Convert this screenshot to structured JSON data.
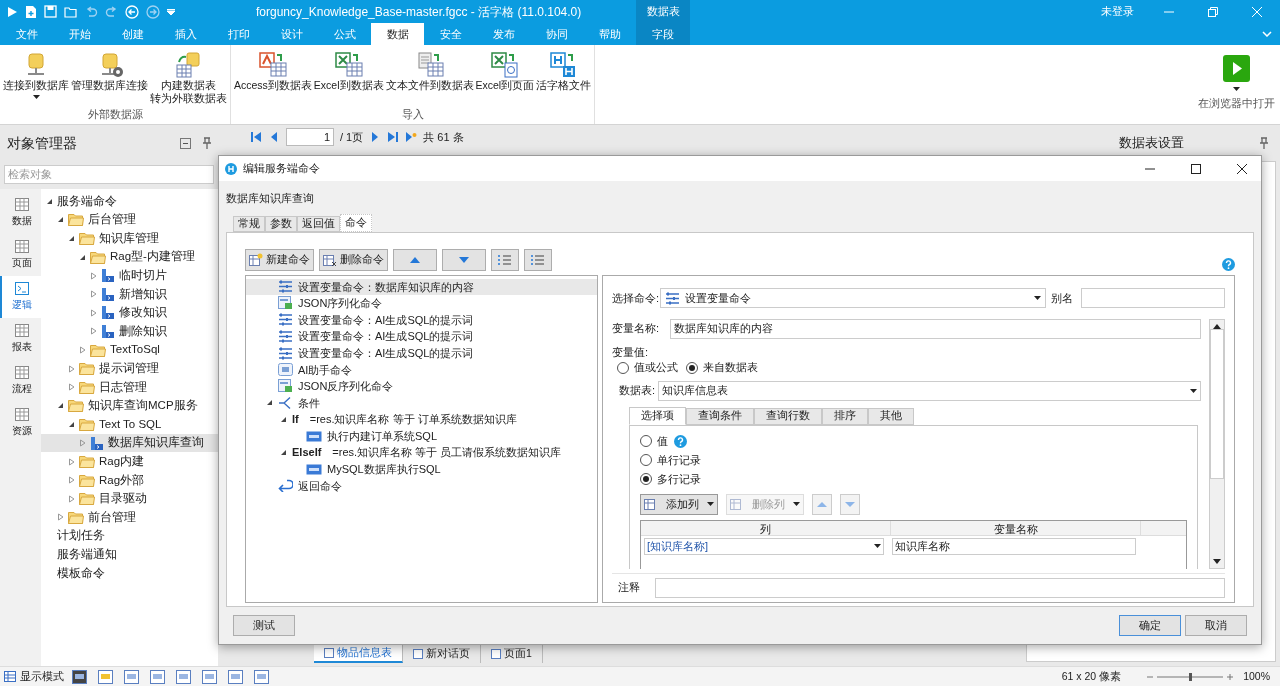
{
  "window": {
    "title": "forguncy_Knowledge_Base-master.fgcc - 活字格 (11.0.104.0)",
    "account": "未登录"
  },
  "ribbon_tabs": [
    {
      "label": "文件",
      "selected": false
    },
    {
      "label": "开始",
      "selected": false
    },
    {
      "label": "创建",
      "selected": false
    },
    {
      "label": "插入",
      "selected": false
    },
    {
      "label": "打印",
      "selected": false
    },
    {
      "label": "设计",
      "selected": false
    },
    {
      "label": "公式",
      "selected": false
    },
    {
      "label": "数据",
      "selected": true
    },
    {
      "label": "安全",
      "selected": false
    },
    {
      "label": "发布",
      "selected": false
    },
    {
      "label": "协同",
      "selected": false
    },
    {
      "label": "帮助",
      "selected": false
    }
  ],
  "context_tabs": {
    "group": "数据表",
    "tabs": [
      {
        "label": "字段"
      }
    ]
  },
  "ribbon_groups": [
    {
      "label": "外部数据源",
      "buttons": [
        {
          "lines": [
            "连接到数据库"
          ],
          "dropdown": true
        },
        {
          "lines": [
            "管理数据库连接"
          ],
          "dropdown": false
        },
        {
          "lines": [
            "内建数据表",
            "转为外联数据表"
          ],
          "dropdown": false
        }
      ]
    },
    {
      "label": "导入",
      "buttons": [
        {
          "lines": [
            "Access到数据表"
          ],
          "dropdown": false
        },
        {
          "lines": [
            "Excel到数据表"
          ],
          "dropdown": false
        },
        {
          "lines": [
            "文本文件到数据表"
          ],
          "dropdown": false
        },
        {
          "lines": [
            "Excel到页面"
          ],
          "dropdown": false
        },
        {
          "lines": [
            "活字格文件"
          ],
          "dropdown": false
        }
      ]
    }
  ],
  "run_button": {
    "label": "在浏览器中打开",
    "dropdown": true
  },
  "object_manager": {
    "title": "对象管理器",
    "search": {
      "placeholder": "检索对象"
    },
    "nav": [
      {
        "label": "数据",
        "selected": false
      },
      {
        "label": "页面",
        "selected": false
      },
      {
        "label": "逻辑",
        "selected": true
      },
      {
        "label": "报表",
        "selected": false
      },
      {
        "label": "流程",
        "selected": false
      },
      {
        "label": "资源",
        "selected": false
      }
    ],
    "tree": [
      {
        "label": "服务端命令",
        "expanded": true,
        "selected": false,
        "children": [
          {
            "label": "后台管理",
            "kind": "folder",
            "expanded": true,
            "selected": false,
            "children": [
              {
                "label": "知识库管理",
                "kind": "folder",
                "expanded": true,
                "selected": false,
                "children": [
                  {
                    "label": "Rag型-内建管理",
                    "kind": "folder",
                    "expanded": true,
                    "selected": false,
                    "children": [
                      {
                        "label": "临时切片",
                        "kind": "command",
                        "expanded": false,
                        "selected": false
                      },
                      {
                        "label": "新增知识",
                        "kind": "command",
                        "expanded": false,
                        "selected": false
                      },
                      {
                        "label": "修改知识",
                        "kind": "command",
                        "expanded": false,
                        "selected": false
                      },
                      {
                        "label": "删除知识",
                        "kind": "command",
                        "expanded": false,
                        "selected": false
                      }
                    ]
                  },
                  {
                    "label": "TextToSql",
                    "kind": "folder",
                    "expanded": false,
                    "selected": false
                  }
                ]
              },
              {
                "label": "提示词管理",
                "kind": "folder",
                "expanded": false,
                "selected": false
              },
              {
                "label": "日志管理",
                "kind": "folder",
                "expanded": false,
                "selected": false
              }
            ]
          },
          {
            "label": "知识库查询MCP服务",
            "kind": "folder",
            "expanded": true,
            "selected": false,
            "children": [
              {
                "label": "Text To SQL",
                "kind": "folder",
                "expanded": true,
                "selected": false,
                "children": [
                  {
                    "label": "数据库知识库查询",
                    "kind": "command",
                    "expanded": false,
                    "selected": true
                  }
                ]
              },
              {
                "label": "Rag内建",
                "kind": "folder",
                "expanded": false,
                "selected": false
              },
              {
                "label": "Rag外部",
                "kind": "folder",
                "expanded": false,
                "selected": false
              },
              {
                "label": "目录驱动",
                "kind": "folder",
                "expanded": false,
                "selected": false
              }
            ]
          },
          {
            "label": "前台管理",
            "kind": "folder",
            "expanded": false,
            "selected": false
          }
        ]
      },
      {
        "label": "计划任务",
        "selected": false
      },
      {
        "label": "服务端通知",
        "selected": false
      },
      {
        "label": "模板命令",
        "selected": false
      }
    ]
  },
  "pager": {
    "page": "1",
    "pages": "/ 1页",
    "total": "共 61 条"
  },
  "settings_panel": {
    "title": "数据表设置"
  },
  "sheet_tabs": [
    {
      "label": "物品信息表",
      "selected": true
    },
    {
      "label": "新对话页",
      "selected": false
    },
    {
      "label": "页面1",
      "selected": false
    }
  ],
  "status_bar": {
    "mode": "显示模式",
    "size": "61 x 20 像素",
    "zoom": "100%"
  },
  "dialog": {
    "title": "编辑服务端命令",
    "name": "数据库知识库查询",
    "tabs": [
      {
        "label": "常规",
        "selected": false
      },
      {
        "label": "参数",
        "selected": false
      },
      {
        "label": "返回值",
        "selected": false
      },
      {
        "label": "命令",
        "selected": true
      }
    ],
    "toolbar": [
      {
        "label": "新建命令"
      },
      {
        "label": "删除命令"
      }
    ],
    "commands": [
      {
        "kind": "variable",
        "label": "设置变量命令：数据库知识库的内容",
        "selected": true
      },
      {
        "kind": "json",
        "label": "JSON序列化命令",
        "selected": false
      },
      {
        "kind": "variable",
        "label": "设置变量命令：AI生成SQL的提示词",
        "selected": false
      },
      {
        "kind": "variable",
        "label": "设置变量命令：AI生成SQL的提示词",
        "selected": false
      },
      {
        "kind": "variable",
        "label": "设置变量命令：AI生成SQL的提示词",
        "selected": false
      },
      {
        "kind": "ai",
        "label": "AI助手命令",
        "selected": false
      },
      {
        "kind": "json",
        "label": "JSON反序列化命令",
        "selected": false
      },
      {
        "kind": "condition",
        "label": "条件",
        "selected": false,
        "expanded": true,
        "children": [
          {
            "kind": "branch",
            "keyword": "If",
            "label": "=res.知识库名称 等于 订单系统数据知识库",
            "selected": false,
            "expanded": true,
            "children": [
              {
                "kind": "sql",
                "label": "执行内建订单系统SQL",
                "selected": false
              }
            ]
          },
          {
            "kind": "branch",
            "keyword": "ElseIf",
            "label": "=res.知识库名称 等于 员工请假系统数据知识库",
            "selected": false,
            "expanded": true,
            "children": [
              {
                "kind": "sql",
                "label": "MySQL数据库执行SQL",
                "selected": false
              }
            ]
          }
        ]
      },
      {
        "kind": "return",
        "label": "返回命令",
        "selected": false
      }
    ],
    "detail": {
      "command_label": "选择命令:",
      "command": "设置变量命令",
      "alias_label": "别名",
      "variable_label": "变量名称:",
      "variable": "数据库知识库的内容",
      "value_label": "变量值:",
      "value_options": [
        {
          "label": "值或公式",
          "selected": false
        },
        {
          "label": "来自数据表",
          "selected": true
        }
      ],
      "table_label": "数据表:",
      "table": "知识库信息表",
      "tabs": [
        {
          "label": "选择项",
          "selected": true
        },
        {
          "label": "查询条件",
          "selected": false
        },
        {
          "label": "查询行数",
          "selected": false
        },
        {
          "label": "排序",
          "selected": false
        },
        {
          "label": "其他",
          "selected": false
        }
      ],
      "result_options": [
        {
          "label": "值",
          "selected": false,
          "help": true
        },
        {
          "label": "单行记录",
          "selected": false,
          "help": false
        },
        {
          "label": "多行记录",
          "selected": true,
          "help": false
        }
      ],
      "column_toolbar": [
        {
          "label": "添加列",
          "disabled": false
        },
        {
          "label": "删除列",
          "disabled": true
        }
      ],
      "grid": {
        "columns": [
          "列",
          "变量名称"
        ],
        "rows": [
          [
            "[知识库名称]",
            "知识库名称"
          ]
        ]
      },
      "note_label": "注释"
    },
    "buttons": {
      "test": "测试",
      "ok": "确定",
      "cancel": "取消"
    }
  }
}
